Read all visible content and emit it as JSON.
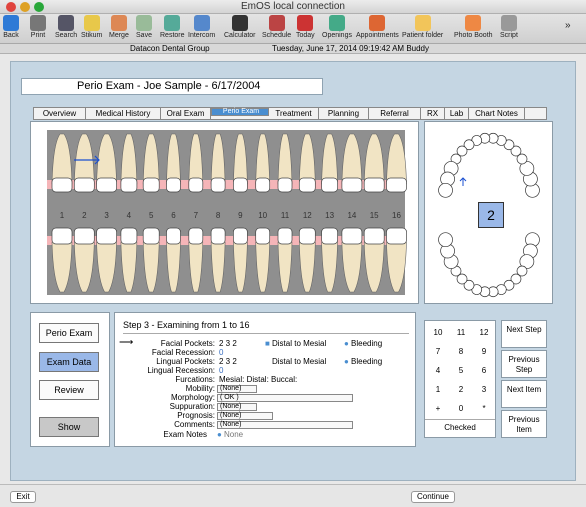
{
  "window": {
    "title": "EmOS local connection"
  },
  "toolbar": {
    "left": [
      "Back",
      "Print",
      "Search",
      "Stikum",
      "Merge",
      "Save",
      "Restore",
      "Intercom",
      "Calculator",
      "Schedule",
      "Today",
      "Openings",
      "Appointments",
      "Patient folder",
      "Photo Booth",
      "Script"
    ],
    "overflow": "»"
  },
  "status": {
    "practice": "Datacon Dental Group",
    "datetime": "Tuesday, June 17, 2014  09:19:42 AM  Buddy"
  },
  "patient": {
    "title": "Perio Exam - Joe Sample -  6/17/2004"
  },
  "tabs": [
    "Overview",
    "Medical History",
    "Oral Exam",
    "Perio Exam",
    "Treatment",
    "Planning",
    "Referral",
    "RX",
    "Lab",
    "Chart Notes"
  ],
  "teeth": {
    "numbers": [
      "1",
      "2",
      "3",
      "4",
      "5",
      "6",
      "7",
      "8",
      "9",
      "10",
      "11",
      "12",
      "13",
      "14",
      "15",
      "16"
    ]
  },
  "arch": {
    "selected": "2"
  },
  "modes": {
    "perio_exam": "Perio Exam",
    "exam_data": "Exam Data",
    "review": "Review",
    "show": "Show"
  },
  "step": {
    "title": "Step 3 - Examining from 1 to 16",
    "facial_pockets_label": "Facial Pockets:",
    "facial_pockets": "2   3   2",
    "distal_mesial": "Distal to Mesial",
    "bleeding": "Bleeding",
    "facial_recession_label": "Facial Recession:",
    "facial_recession": "0",
    "lingual_pockets_label": "Lingual Pockets:",
    "lingual_pockets": "2   3   2",
    "lingual_recession_label": "Lingual Recession:",
    "lingual_recession": "0",
    "furcations_label": "Furcations:",
    "furcations": "Mesial:     Distal:     Buccal:",
    "mobility_label": "Mobility:",
    "mobility": "(None)",
    "morphology_label": "Morphology:",
    "morphology": "( OK )",
    "suppuration_label": "Suppuration:",
    "suppuration": "(None)",
    "prognosis_label": "Prognosis:",
    "prognosis": "(None)",
    "comments_label": "Comments:",
    "comments": "(None)",
    "notes_label": "Exam Notes",
    "notes": "None"
  },
  "keypad": {
    "keys": [
      "10",
      "11",
      "12",
      "7",
      "8",
      "9",
      "4",
      "5",
      "6",
      "1",
      "2",
      "3",
      "+",
      "0",
      "*"
    ],
    "status": "Checked"
  },
  "nav": {
    "next_step": "Next Step",
    "prev_step": "Previous Step",
    "next_item": "Next Item",
    "prev_item": "Previous Item"
  },
  "footer": {
    "exit": "Exit",
    "continue": "Continue"
  },
  "colors": {
    "accent": "#4a8ed0",
    "panel": "#c5d6e3",
    "gum": "#f5b5b8",
    "tooth": "#f1e4c4"
  }
}
